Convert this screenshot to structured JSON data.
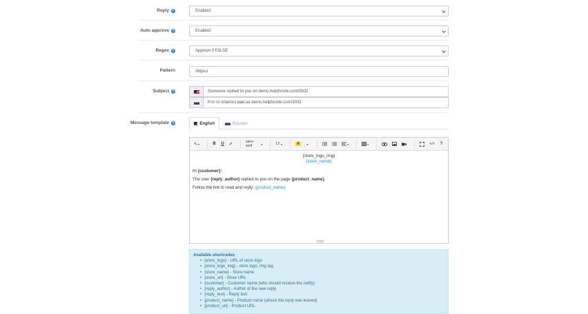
{
  "fields": {
    "reply": {
      "label": "Reply",
      "value": "Enabled"
    },
    "auto_approve": {
      "label": "Auto approve",
      "value": "Enabled"
    },
    "regex": {
      "label": "Regex",
      "value": "Approve if FALSE"
    },
    "pattern": {
      "label": "Pattern",
      "value": "/http/ui"
    },
    "subject": {
      "label": "Subject",
      "en": "Someone replied to you on demo.helpforsite.com/3032",
      "ru": "Кто-то ответил вам на demo.helpforsite.com/3032"
    },
    "message_template": {
      "label": "Message template"
    }
  },
  "help_icon": "?",
  "tabs": [
    {
      "label": "English",
      "flag": "en"
    },
    {
      "label": "Russian",
      "flag": "ru"
    }
  ],
  "toolbar": {
    "magic": "✎",
    "bold": "B",
    "underline": "U",
    "eraser": "✐",
    "font_family": "sans-serif",
    "font_size": "13",
    "color": "A",
    "help": "?"
  },
  "editor": {
    "logo_img": "{store_logo_img}",
    "store_name": "{store_name}",
    "hi_prefix": "Hi ",
    "customer": "{customer}",
    "hi_suffix": "!",
    "user_prefix": "The user ",
    "reply_author": "{reply_author}",
    "user_middle": " replied to you on the page ",
    "product_name": "{product_name}",
    "user_suffix": ".",
    "follow_text": "Follow the link to read and reply: ",
    "product_link": "{product_name}"
  },
  "shortcuts": {
    "title": "Available shortcodes",
    "items": [
      "{store_logo} - URL of store logo",
      "{store_logo_img} - store logo, img tag",
      "{store_name} - Store name",
      "{store_url} - Store URL",
      "{customer} - Customer name (who should receive the notify)",
      "{reply_author} - Author of the new reply",
      "{reply_text} - Reply text",
      "{product_name} - Product name (where the reply was leaved)",
      "{product_url} - Product URL"
    ]
  },
  "colors": {
    "accent": "#1e91cf",
    "info_bg": "#d9edf7",
    "info_text": "#31708f"
  }
}
